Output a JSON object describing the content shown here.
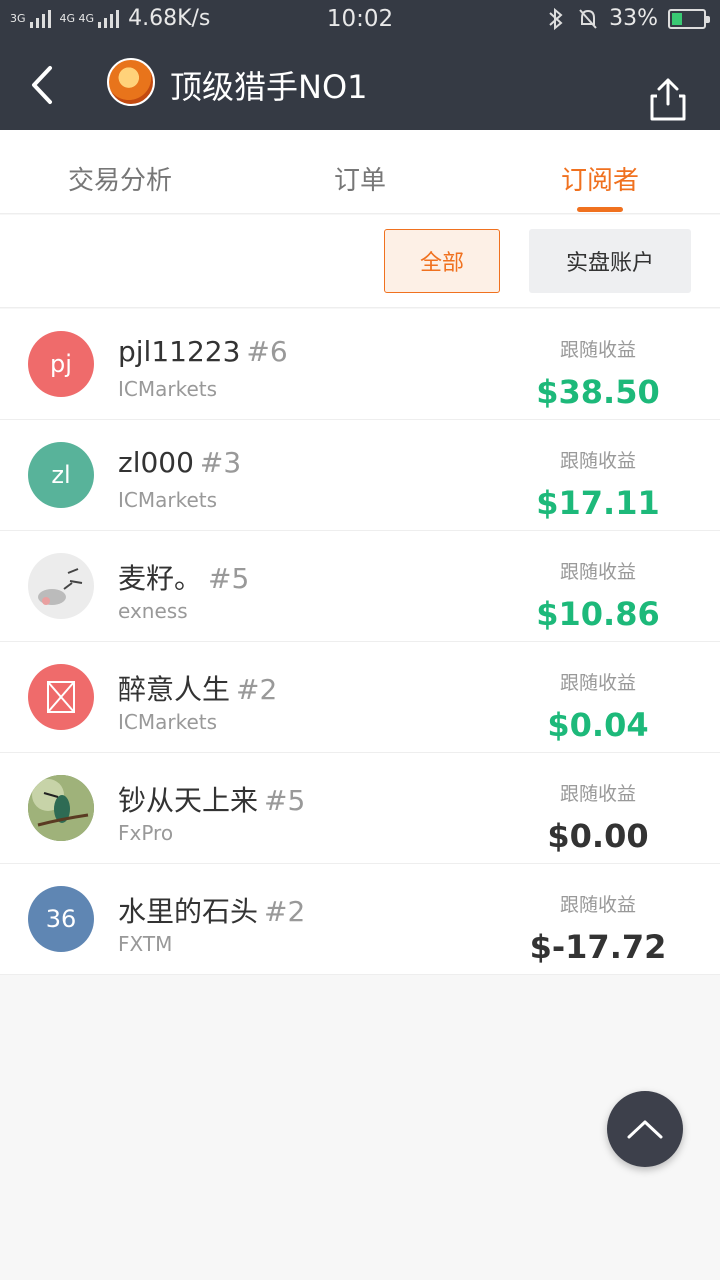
{
  "status_bar": {
    "network_1": "3G",
    "network_2": "4G 4G",
    "speed": "4.68K/s",
    "time": "10:02",
    "battery": "33%",
    "battery_level": 0.33
  },
  "header": {
    "title": "顶级猎手NO1"
  },
  "tabs": [
    {
      "label": "交易分析",
      "active": false
    },
    {
      "label": "订单",
      "active": false
    },
    {
      "label": "订阅者",
      "active": true
    }
  ],
  "filters": {
    "all_label": "全部",
    "real_label": "实盘账户"
  },
  "subscribers": [
    {
      "avatar_text": "pj",
      "avatar_color": "#ef6b6b",
      "name": "pjl11223",
      "rank": "#6",
      "broker": "ICMarkets",
      "label": "跟随收益",
      "amount": "$38.50",
      "amount_color": "#1db97a"
    },
    {
      "avatar_text": "zl",
      "avatar_color": "#58b39a",
      "name": "zl000",
      "rank": "#3",
      "broker": "ICMarkets",
      "label": "跟随收益",
      "amount": "$17.11",
      "amount_color": "#1db97a"
    },
    {
      "avatar_text": "",
      "avatar_color": "#ececec",
      "name": "麦籽。",
      "rank": "#5",
      "broker": "exness",
      "label": "跟随收益",
      "amount": "$10.86",
      "amount_color": "#1db97a"
    },
    {
      "avatar_text": "",
      "avatar_color": "#ef6b6b",
      "name": "醉意人生",
      "rank": "#2",
      "broker": "ICMarkets",
      "label": "跟随收益",
      "amount": "$0.04",
      "amount_color": "#1db97a"
    },
    {
      "avatar_text": "",
      "avatar_color": "#6b8a4e",
      "name": "钞从天上来",
      "rank": "#5",
      "broker": "FxPro",
      "label": "跟随收益",
      "amount": "$0.00",
      "amount_color": "#333333"
    },
    {
      "avatar_text": "36",
      "avatar_color": "#5f86b3",
      "name": "水里的石头",
      "rank": "#2",
      "broker": "FXTM",
      "label": "跟随收益",
      "amount": "$-17.72",
      "amount_color": "#333333"
    }
  ],
  "colors": {
    "header_bg": "#353a44",
    "accent": "#f0711f",
    "profit": "#1db97a"
  }
}
